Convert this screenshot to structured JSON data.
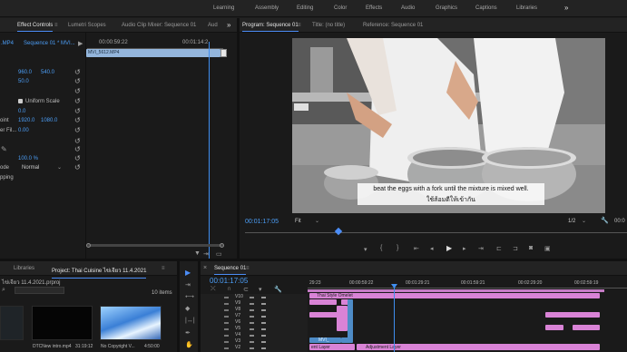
{
  "workspaces": [
    "Learning",
    "Assembly",
    "Editing",
    "Color",
    "Effects",
    "Audio",
    "Graphics",
    "Captions",
    "Libraries"
  ],
  "workspaces_more": "»",
  "source_panel": {
    "tabs": [
      "Effect Controls",
      "Lumetri Scopes",
      "Audio Clip Mixer: Sequence 01",
      "Aud"
    ],
    "tab_menu": "≡",
    "more": "»",
    "clip_selector": ".MP4",
    "sequence_selector": "Sequence 01 * MVI...",
    "timecode_start": "00:00:59:22",
    "timecode_end": "00:01:14:2",
    "clip_name": "MVI_5612.MP4",
    "values": {
      "position_x": "960.0",
      "position_y": "540.0",
      "scale": "50.0",
      "uniform_scale": "Uniform Scale",
      "rotation": "0.0",
      "anchor_label": "oint",
      "anchor_x": "1920.0",
      "anchor_y": "1080.0",
      "flicker_label": "er Fil...",
      "flicker": "0.00",
      "opacity": "100.0 %",
      "blend_label": "ode",
      "blend": "Normal",
      "time_remap": "pping"
    },
    "current_time": "00:01:17:05"
  },
  "program_monitor": {
    "tabs": [
      "Program: Sequence 01",
      "Title: (no title)",
      "Reference: Sequence 01"
    ],
    "tab_menu": "≡",
    "subtitle_line1": "beat the eggs with a fork until the mixture is mixed well.",
    "subtitle_line2": "ใช้ส้อมตีให้เข้ากัน",
    "timecode": "00:01:17:05",
    "fit": "Fit",
    "resolution": "1/2",
    "duration": "00:0"
  },
  "project_panel": {
    "tabs": [
      "Libraries",
      "Project: Thai Cuisine ไข่เจียว 11.4.2021"
    ],
    "tab_menu": "≡",
    "project_file": "ไข่เจียว 11.4.2021.prproj",
    "items_count": "10 items",
    "items": [
      {
        "name": "",
        "duration": ""
      },
      {
        "name": "DTCNew intro.mp4",
        "duration": "31:19:12"
      },
      {
        "name": "No Copyright V...",
        "duration": "4:50:00"
      }
    ]
  },
  "timeline": {
    "tab": "Sequence 01",
    "tab_menu": "≡",
    "timecode": "00:01:17:05",
    "ruler": [
      "29:23",
      "00:00:59:22",
      "00:01:29:21",
      "00:01:59:21",
      "00:02:29:20",
      "00:02:59:19"
    ],
    "tracks": [
      "V10",
      "V9",
      "V8",
      "V7",
      "V6",
      "V5",
      "V4",
      "V3",
      "V2"
    ],
    "clips": {
      "title_clip": "Thai Style Omelet",
      "mvi_clip": "MVI_",
      "adjustment1": "ent Layer",
      "adjustment2": "Adjustment Layer"
    }
  },
  "colors": {
    "accent_blue": "#4c9ef7",
    "clip_pink": "#d983d6",
    "clip_blue": "#4e8cc7",
    "playhead": "#3f8ef0"
  }
}
